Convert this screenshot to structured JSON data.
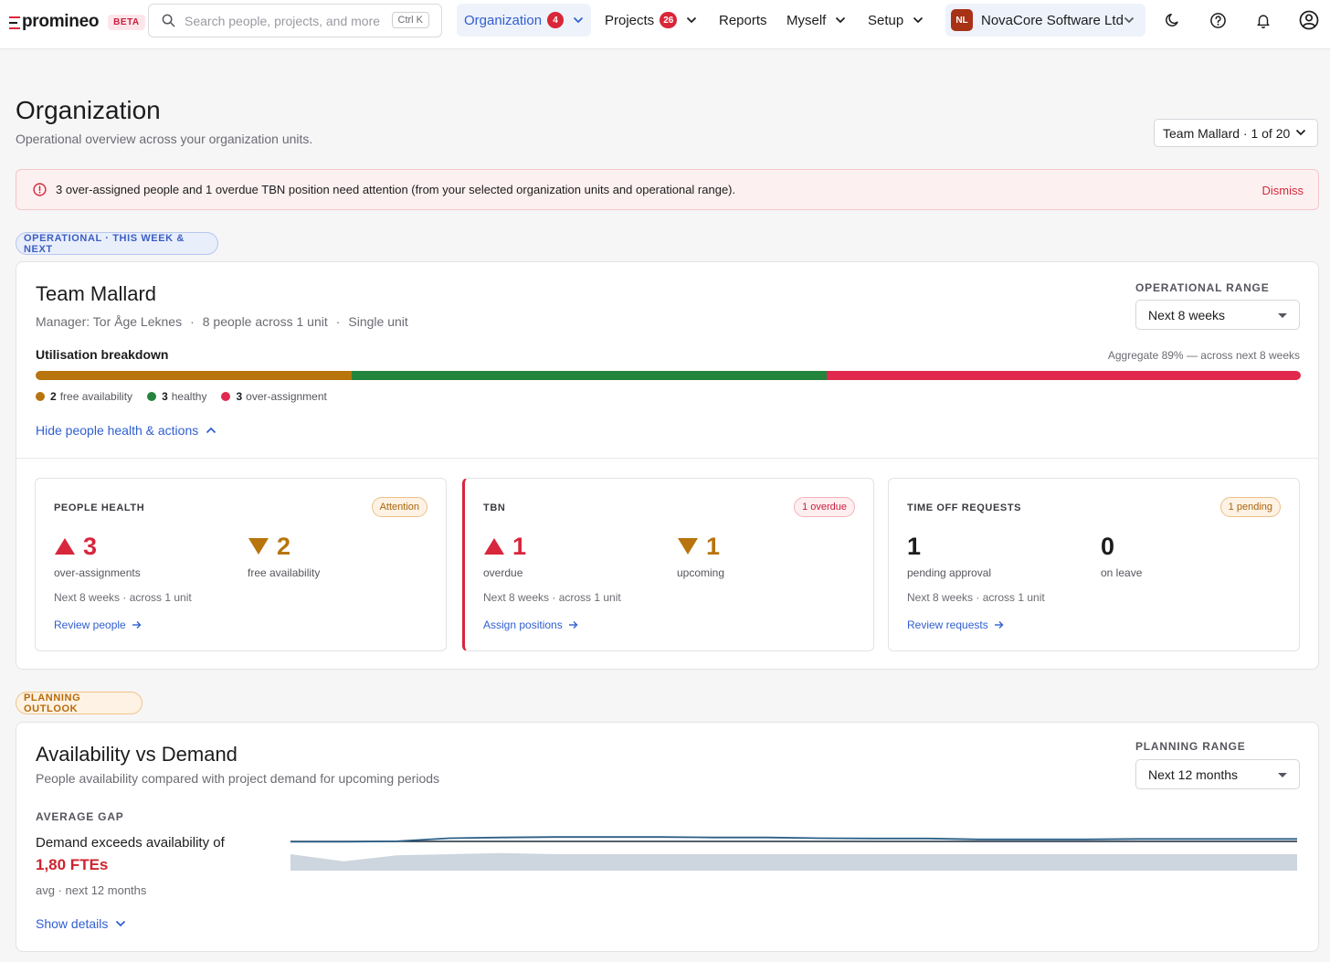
{
  "app": {
    "logo_text": "promineo",
    "beta_label": "BETA"
  },
  "search": {
    "placeholder": "Search people, projects, and more",
    "shortcut": "Ctrl K"
  },
  "nav": {
    "organization": {
      "label": "Organization",
      "badge": "4"
    },
    "projects": {
      "label": "Projects",
      "badge": "26"
    },
    "reports": {
      "label": "Reports"
    },
    "myself": {
      "label": "Myself"
    },
    "setup": {
      "label": "Setup"
    }
  },
  "org_switcher": {
    "initials": "NL",
    "name": "NovaCore Software Ltd",
    "avatar_color": "#a83216"
  },
  "page": {
    "title": "Organization",
    "subtitle": "Operational overview across your organization units.",
    "team_selector": "Team Mallard · 1 of 20"
  },
  "alert": {
    "text": "3 over-assigned people and 1 overdue TBN position need attention (from your selected organization units and operational range).",
    "dismiss": "Dismiss"
  },
  "sections": {
    "operational_tag": "OPERATIONAL · THIS WEEK & NEXT",
    "planning_tag": "PLANNING OUTLOOK"
  },
  "team": {
    "name": "Team Mallard",
    "manager": "Manager: Tor Åge Leknes",
    "people": "8 people across 1 unit",
    "scope": "Single unit",
    "range_label": "OPERATIONAL RANGE",
    "range_value": "Next 8 weeks",
    "util_label": "Utilisation breakdown",
    "util_aggregate": "Aggregate 89% — across next 8 weeks",
    "breakdown": [
      {
        "count": "2",
        "label": "free availability",
        "fraction": 0.25,
        "color": "#b8740d"
      },
      {
        "count": "3",
        "label": "healthy",
        "fraction": 0.375,
        "color": "#23843c"
      },
      {
        "count": "3",
        "label": "over-assignment",
        "fraction": 0.375,
        "color": "#e0294d"
      }
    ],
    "toggle_label": "Hide people health & actions"
  },
  "cards": {
    "people_health": {
      "title": "PEOPLE HEALTH",
      "pill": "Attention",
      "stat1_value": "3",
      "stat1_label": "over-assignments",
      "stat2_value": "2",
      "stat2_label": "free availability",
      "note": "Next 8 weeks · across 1 unit",
      "link": "Review people"
    },
    "tbn": {
      "title": "TBN",
      "pill": "1 overdue",
      "stat1_value": "1",
      "stat1_label": "overdue",
      "stat2_value": "1",
      "stat2_label": "upcoming",
      "note": "Next 8 weeks · across 1 unit",
      "link": "Assign positions"
    },
    "time_off": {
      "title": "TIME OFF REQUESTS",
      "pill": "1 pending",
      "stat1_value": "1",
      "stat1_label": "pending approval",
      "stat2_value": "0",
      "stat2_label": "on leave",
      "note": "Next 8 weeks · across 1 unit",
      "link": "Review requests"
    }
  },
  "availability": {
    "title": "Availability vs Demand",
    "subtitle": "People availability compared with project demand for upcoming periods",
    "range_label": "PLANNING RANGE",
    "range_value": "Next 12 months",
    "gap_label": "AVERAGE GAP",
    "gap_text": "Demand exceeds availability of",
    "gap_value": "1,80 FTEs",
    "gap_note": "avg · next 12 months",
    "show_details": "Show details",
    "sparkline": {
      "availability": [
        0.5,
        0.2,
        0.45,
        0.5,
        0.55,
        0.5,
        0.5,
        0.5,
        0.5,
        0.5,
        0.5,
        0.5,
        0.5,
        0.5,
        0.5,
        0.5,
        0.5,
        0.5,
        0.5,
        0.5
      ],
      "demand": [
        0.6,
        0.6,
        0.62,
        0.75,
        0.78,
        0.8,
        0.8,
        0.8,
        0.78,
        0.78,
        0.75,
        0.74,
        0.74,
        0.7,
        0.7,
        0.7,
        0.72,
        0.72,
        0.72,
        0.72
      ]
    }
  },
  "colors": {
    "accent": "#2f5fd0",
    "danger": "#d92638",
    "warning": "#b8740d",
    "success": "#23843c"
  }
}
